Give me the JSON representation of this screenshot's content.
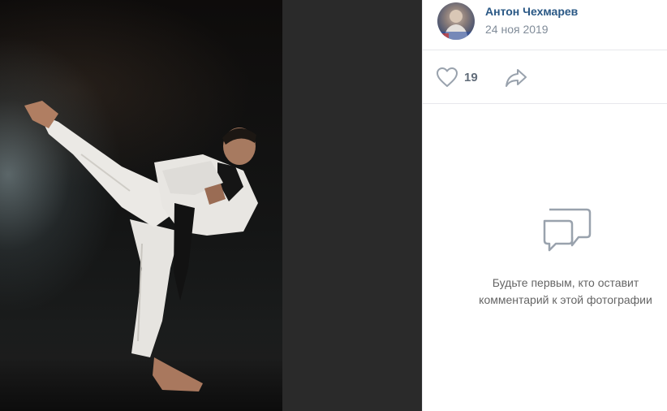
{
  "author": {
    "name": "Антон Чехмарев",
    "date": "24 ноя 2019",
    "avatar_icon": "user-avatar"
  },
  "actions": {
    "like_icon": "heart-icon",
    "like_count": "19",
    "share_icon": "share-arrow-icon"
  },
  "comments": {
    "empty_icon": "comment-bubbles-icon",
    "empty_line1": "Будьте первым, кто оставит",
    "empty_line2": "комментарий к этой фотографии"
  },
  "colors": {
    "accent": "#2a5885",
    "muted": "#818c99",
    "icon": "#99a2ad",
    "viewer_bg": "#2a2a2a"
  }
}
